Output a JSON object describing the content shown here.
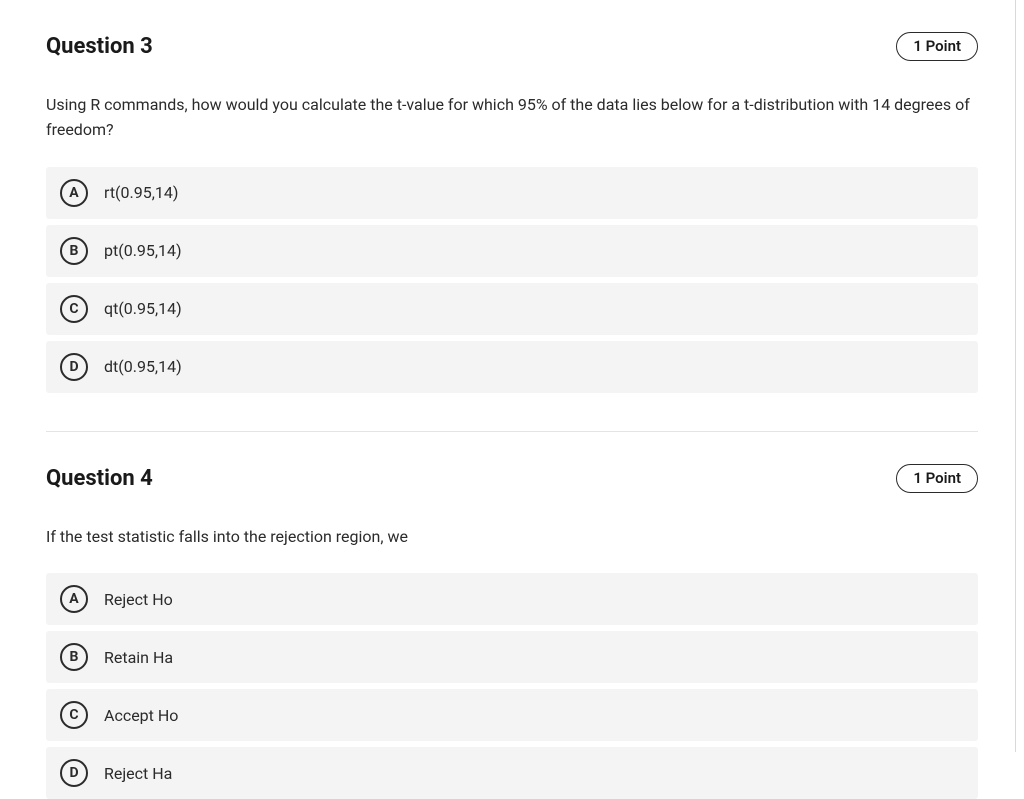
{
  "questions": [
    {
      "title": "Question 3",
      "points": "1 Point",
      "prompt": "Using R commands, how would you calculate the t-value for which 95% of the data lies below for a t-distribution with 14 degrees of freedom?",
      "options": [
        {
          "letter": "A",
          "text": "rt(0.95,14)"
        },
        {
          "letter": "B",
          "text": "pt(0.95,14)"
        },
        {
          "letter": "C",
          "text": "qt(0.95,14)"
        },
        {
          "letter": "D",
          "text": "dt(0.95,14)"
        }
      ]
    },
    {
      "title": "Question 4",
      "points": "1 Point",
      "prompt": "If the test statistic falls into the rejection region, we",
      "options": [
        {
          "letter": "A",
          "text": "Reject Ho"
        },
        {
          "letter": "B",
          "text": "Retain Ha"
        },
        {
          "letter": "C",
          "text": "Accept Ho"
        },
        {
          "letter": "D",
          "text": "Reject Ha"
        }
      ]
    }
  ]
}
